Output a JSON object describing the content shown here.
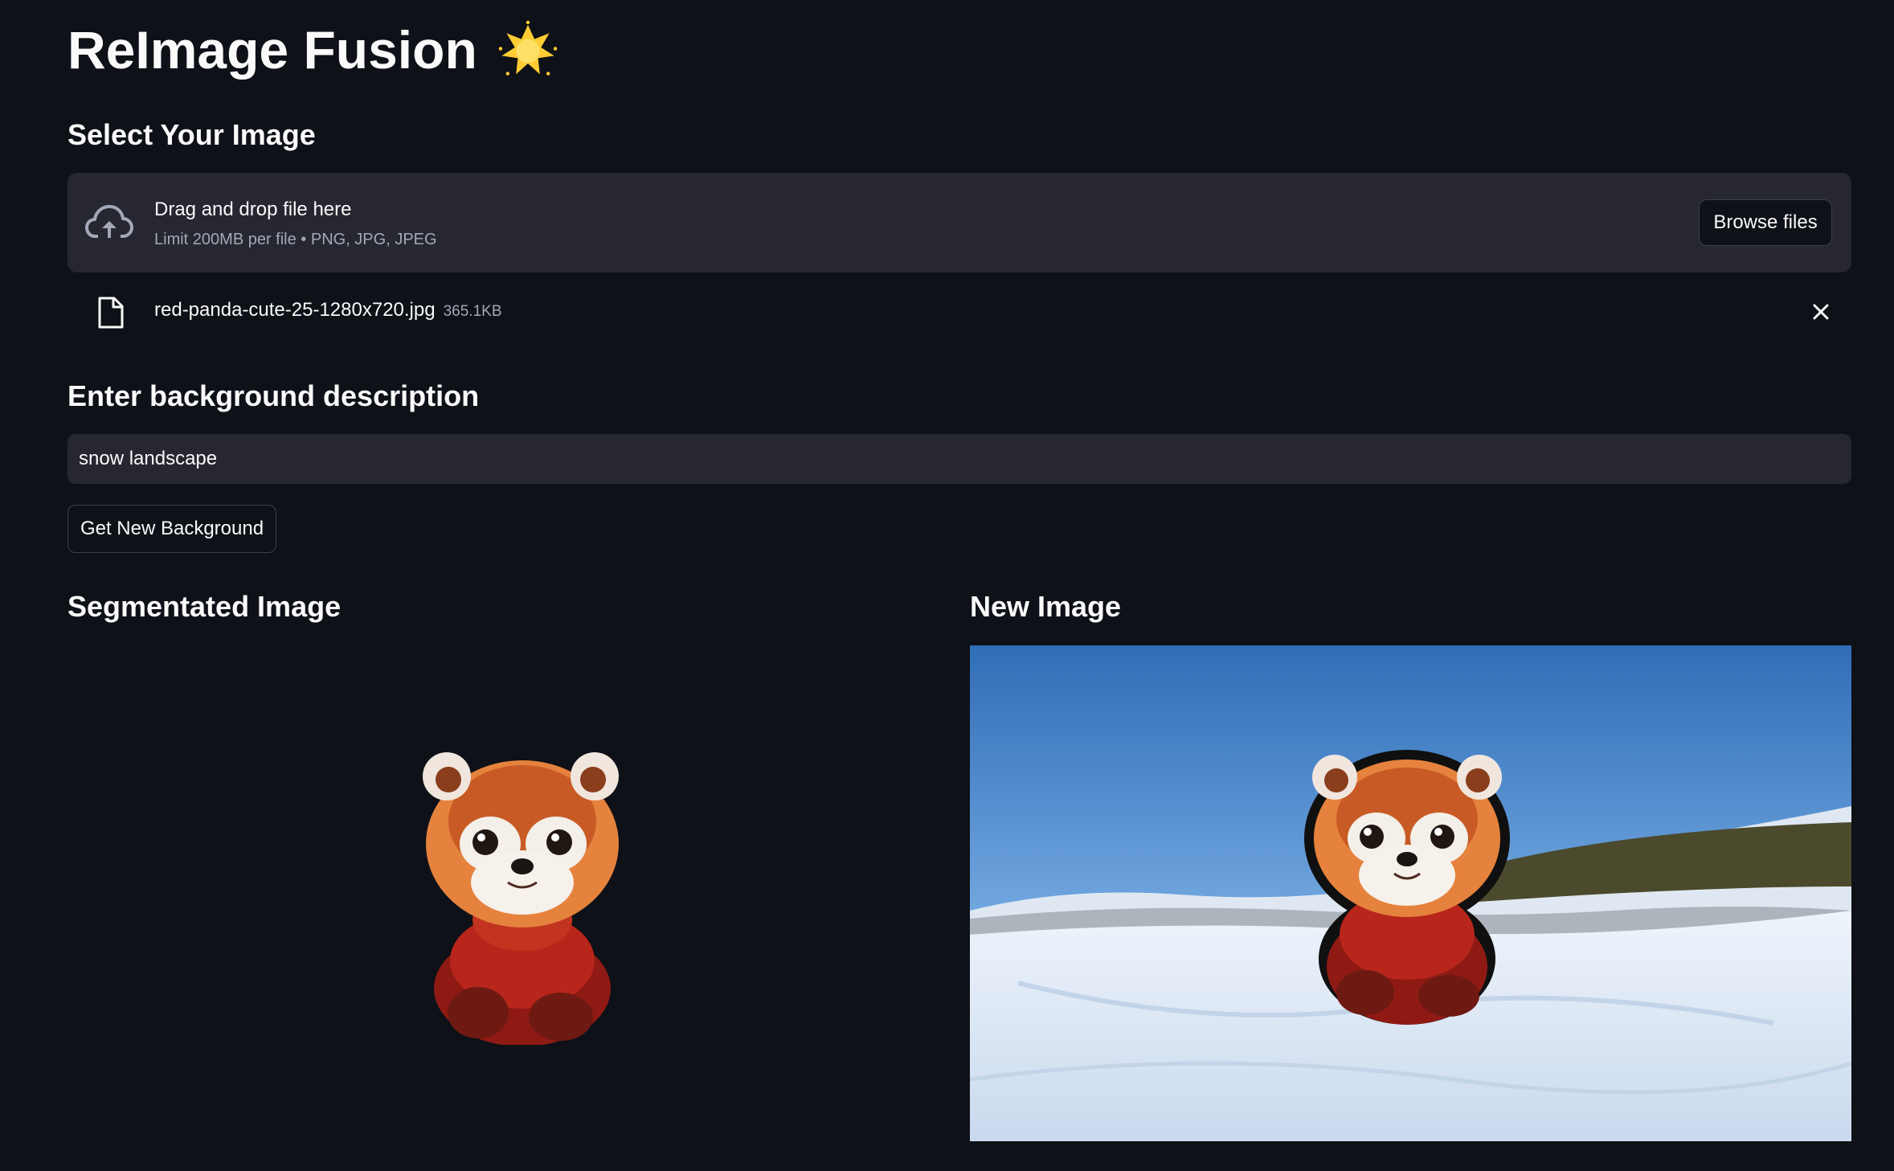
{
  "app": {
    "title": "ReImage Fusion",
    "title_icon": "star-glow-icon"
  },
  "upload": {
    "heading": "Select Your Image",
    "drop_text": "Drag and drop file here",
    "limit_text": "Limit 200MB per file • PNG, JPG, JPEG",
    "browse_label": "Browse files",
    "file": {
      "name": "red-panda-cute-25-1280x720.jpg",
      "size": "365.1KB"
    }
  },
  "background": {
    "heading": "Enter background description",
    "input_value": "snow landscape",
    "button_label": "Get New Background"
  },
  "results": {
    "segmented_heading": "Segmentated Image",
    "new_heading": "New Image"
  },
  "colors": {
    "bg": "#0e1117",
    "panel": "#262730",
    "text": "#fafafa",
    "muted": "#a3a8b8",
    "emoji": "#ffcc33"
  }
}
